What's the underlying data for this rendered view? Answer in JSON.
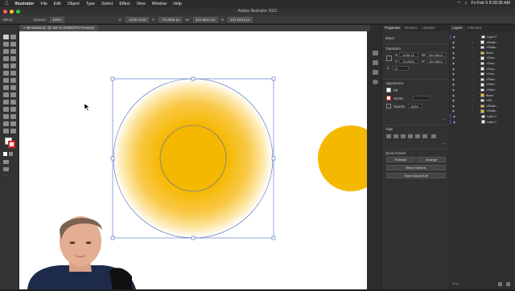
{
  "menubar": {
    "app": "Illustrator",
    "items": [
      "File",
      "Edit",
      "Object",
      "Type",
      "Select",
      "Effect",
      "View",
      "Window",
      "Help"
    ],
    "datetime": "Fri Feb 5  8:28:35 AM"
  },
  "titlebar": {
    "title": "Adobe Illustrator 2021"
  },
  "controlbar": {
    "selection_label": "Blend",
    "opacity_label": "Opacity:",
    "opacity_value": "100%",
    "x_label": "X:",
    "x_value": "-1030.1218",
    "y_label": "Y:",
    "y_value": "-70.2925 px",
    "w_label": "W:",
    "w_value": "421.6513 px",
    "h_label": "H:",
    "h_value": "421.6513 px"
  },
  "document": {
    "tab_label": "Minimalist.ai* @ 150 % (RGB/CPU Preview)"
  },
  "properties": {
    "tabs": [
      "Properties",
      "Brushes",
      "Libraries"
    ],
    "selection_type": "Blend",
    "transform_heading": "Transform",
    "x_label": "X:",
    "x_value": "-1030.12",
    "y_label": "Y:",
    "y_value": "-70.2925",
    "w_label": "W:",
    "w_value": "421.6513",
    "h_label": "H:",
    "h_value": "421.6513",
    "angle_value": "0°",
    "appearance_heading": "Appearance",
    "fill_label": "Fill",
    "stroke_label": "Stroke",
    "opacity_label": "Opacity",
    "opacity_value": "100%",
    "align_heading": "Align",
    "quick_actions_heading": "Quick Actions",
    "release_label": "Release",
    "arrange_label": "Arrange",
    "blend_options_label": "Blend Options",
    "global_edit_label": "Start Global Edit"
  },
  "layers": {
    "tabs": [
      "Layers",
      "Artboards"
    ],
    "rows": [
      {
        "name": "Layer 3",
        "thumb": "#ffffff"
      },
      {
        "name": "<Radia...",
        "thumb": "#ffffff"
      },
      {
        "name": "<Radia...",
        "thumb": "#ffffff"
      },
      {
        "name": "Blend",
        "thumb": "#f5bd22"
      },
      {
        "name": "<Grou...",
        "thumb": "#ffffff"
      },
      {
        "name": "<Grou...",
        "thumb": "#ffffff"
      },
      {
        "name": "<Grou...",
        "thumb": "#ffffff"
      },
      {
        "name": "<Grou...",
        "thumb": "#ffffff"
      },
      {
        "name": "<Path>",
        "thumb": "#ffffff"
      },
      {
        "name": "<Path>",
        "thumb": "#ffffff"
      },
      {
        "name": "<Path>",
        "thumb": "#ffffff"
      },
      {
        "name": "Blend",
        "thumb": "#f5bd22"
      },
      {
        "name": "<Elli...",
        "thumb": "#ffffff"
      },
      {
        "name": "<Radia...",
        "thumb": "#f5bd22"
      },
      {
        "name": "<Radia...",
        "thumb": "#f5bd22"
      },
      {
        "name": "Layer 2",
        "thumb": "#ffffff"
      },
      {
        "name": "Layer 1",
        "thumb": "#ffffff"
      }
    ],
    "footer": "3 La..."
  },
  "colors": {
    "sun_yellow": "#f5b800",
    "selection_blue": "#4a67c8",
    "panel_bg": "#323232",
    "layer_accent": "#3b5bd9"
  }
}
